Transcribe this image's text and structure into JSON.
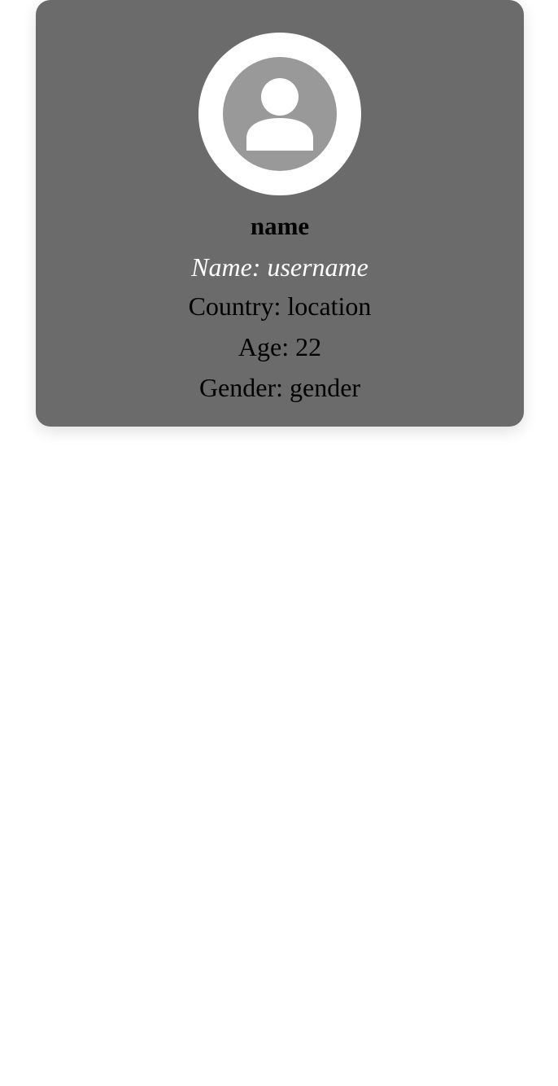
{
  "profile": {
    "avatar_icon": "user-icon",
    "name": "name",
    "username_line": "Name: username",
    "country_line": "Country: location",
    "age_line": "Age: 22",
    "gender_line": "Gender: gender"
  },
  "colors": {
    "card_background": "#6b6b6b",
    "avatar_ring": "#ffffff",
    "avatar_fill": "#999999",
    "username_text": "#ffffff",
    "body_text": "#000000"
  }
}
